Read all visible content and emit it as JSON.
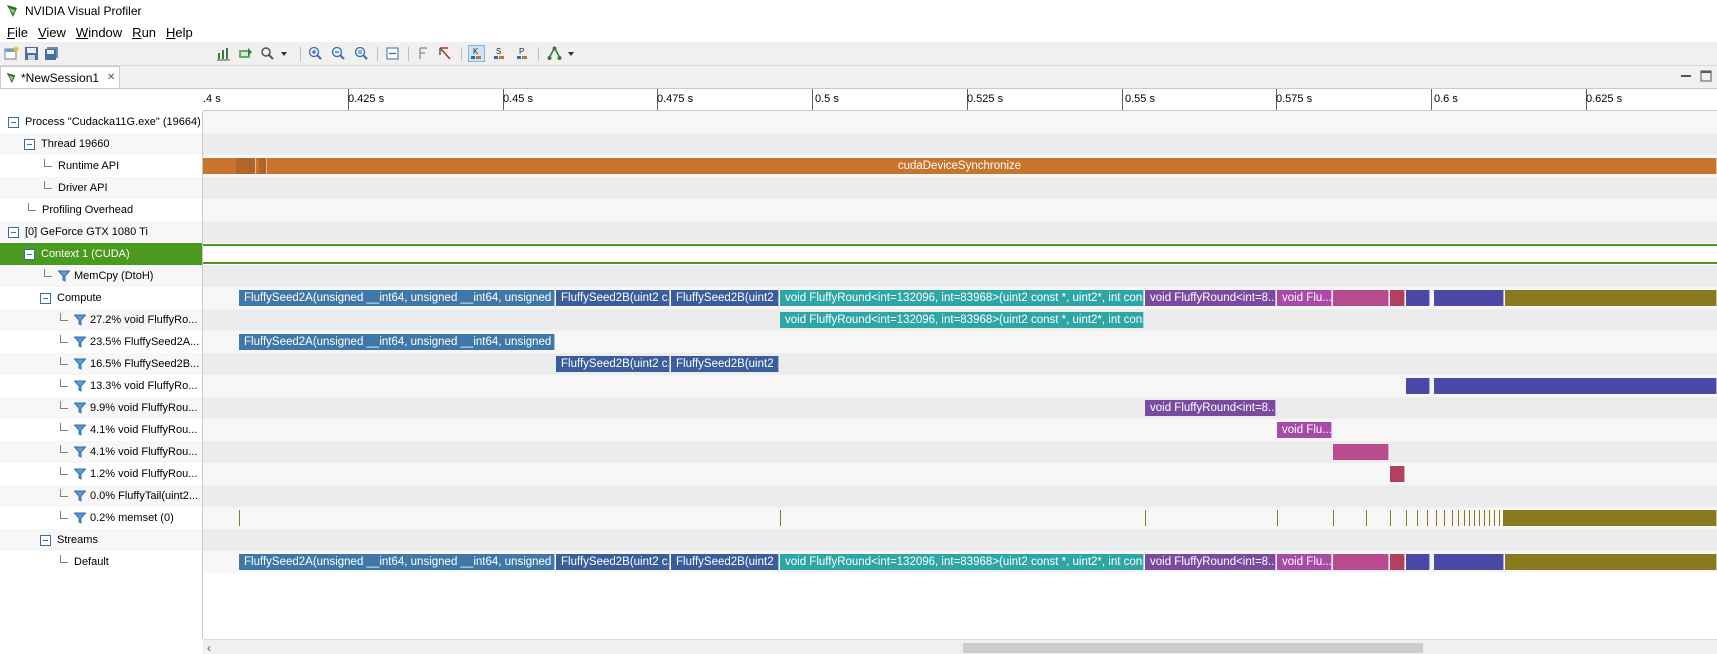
{
  "window": {
    "title": "NVIDIA Visual Profiler"
  },
  "menu": [
    {
      "label": "File",
      "mnemonic": "F",
      "rest": "ile"
    },
    {
      "label": "View",
      "mnemonic": "V",
      "rest": "iew"
    },
    {
      "label": "Window",
      "mnemonic": "W",
      "rest": "indow"
    },
    {
      "label": "Run",
      "mnemonic": "R",
      "rest": "un"
    },
    {
      "label": "Help",
      "mnemonic": "H",
      "rest": "elp"
    }
  ],
  "toolbar": {
    "buttons": [
      "new-session-icon",
      "save-icon",
      "save-all-icon",
      "new-chart-icon",
      "import-icon",
      "search-icon",
      "dropdown-icon",
      "zoom-in-icon",
      "zoom-out-icon",
      "zoom-fit-icon",
      "collapse-icon",
      "filter-icon",
      "pointer-icon",
      "kernel-view-icon",
      "stream-view-icon",
      "process-view-icon",
      "analysis-icon",
      "dropdown-icon"
    ],
    "k_label": "K",
    "s_label": "S",
    "p_label": "P"
  },
  "tab": {
    "label": "*NewSession1",
    "close": "✕"
  },
  "ruler": {
    "ticks": [
      "0.4 s",
      "0.425 s",
      "0.45 s",
      "0.475 s",
      "0.5 s",
      "0.525 s",
      "0.55 s",
      "0.575 s",
      "0.6 s",
      "0.625 s"
    ],
    "first_visible": ".4 s"
  },
  "tree": [
    {
      "label": "Process \"Cudacka11G.exe\" (19664)",
      "kind": "minus",
      "indent": 0
    },
    {
      "label": "Thread 19660",
      "kind": "minus",
      "indent": 1
    },
    {
      "label": "Runtime API",
      "kind": "elbow",
      "indent": 2
    },
    {
      "label": "Driver API",
      "kind": "elbow",
      "indent": 2
    },
    {
      "label": "Profiling Overhead",
      "kind": "elbow",
      "indent": 1
    },
    {
      "label": "[0] GeForce GTX 1080 Ti",
      "kind": "minus",
      "indent": 0
    },
    {
      "label": "Context 1 (CUDA)",
      "kind": "minus",
      "indent": 1
    },
    {
      "label": "MemCpy (DtoH)",
      "kind": "filter",
      "indent": 2
    },
    {
      "label": "Compute",
      "kind": "minus",
      "indent": 2
    },
    {
      "label": "27.2% void FluffyRo...",
      "kind": "filter",
      "indent": 3
    },
    {
      "label": "23.5% FluffySeed2A...",
      "kind": "filter",
      "indent": 3
    },
    {
      "label": "16.5% FluffySeed2B...",
      "kind": "filter",
      "indent": 3
    },
    {
      "label": "13.3% void FluffyRo...",
      "kind": "filter",
      "indent": 3
    },
    {
      "label": "9.9% void FluffyRou...",
      "kind": "filter",
      "indent": 3
    },
    {
      "label": "4.1% void FluffyRou...",
      "kind": "filter",
      "indent": 3
    },
    {
      "label": "4.1% void FluffyRou...",
      "kind": "filter",
      "indent": 3
    },
    {
      "label": "1.2% void FluffyRou...",
      "kind": "filter",
      "indent": 3
    },
    {
      "label": "0.0% FluffyTail(uint2...",
      "kind": "filter",
      "indent": 3
    },
    {
      "label": "0.2% memset (0)",
      "kind": "filter",
      "indent": 3
    },
    {
      "label": "Streams",
      "kind": "minus",
      "indent": 2
    },
    {
      "label": "Default",
      "kind": "elbow",
      "indent": 3
    }
  ],
  "bars": {
    "runtime_api": "cudaDeviceSynchronize",
    "seed2a": "FluffySeed2A(unsigned __int64, unsigned __int64, unsigned __i...",
    "seed2b_1": "FluffySeed2B(uint2 c...",
    "seed2b_2": "FluffySeed2B(uint2 ...",
    "round_main": "void FluffyRound<int=132096, int=83968>(uint2 const *, uint2*, int const...",
    "round_8": "void FluffyRound<int=8...",
    "round_flu": "void Flu..."
  },
  "colors": {
    "runtime": "#c8742a",
    "seed2a": "#3f78a8",
    "seed2b": "#3a5d9c",
    "round_main": "#2fa6a6",
    "round_8": "#7a4aa0",
    "round_flu": "#a94aa8",
    "pink": "#b84a8e",
    "red": "#b24060",
    "navy": "#4a4aa6",
    "memset": "#8a7a1f",
    "context": "#4a9a1f"
  }
}
